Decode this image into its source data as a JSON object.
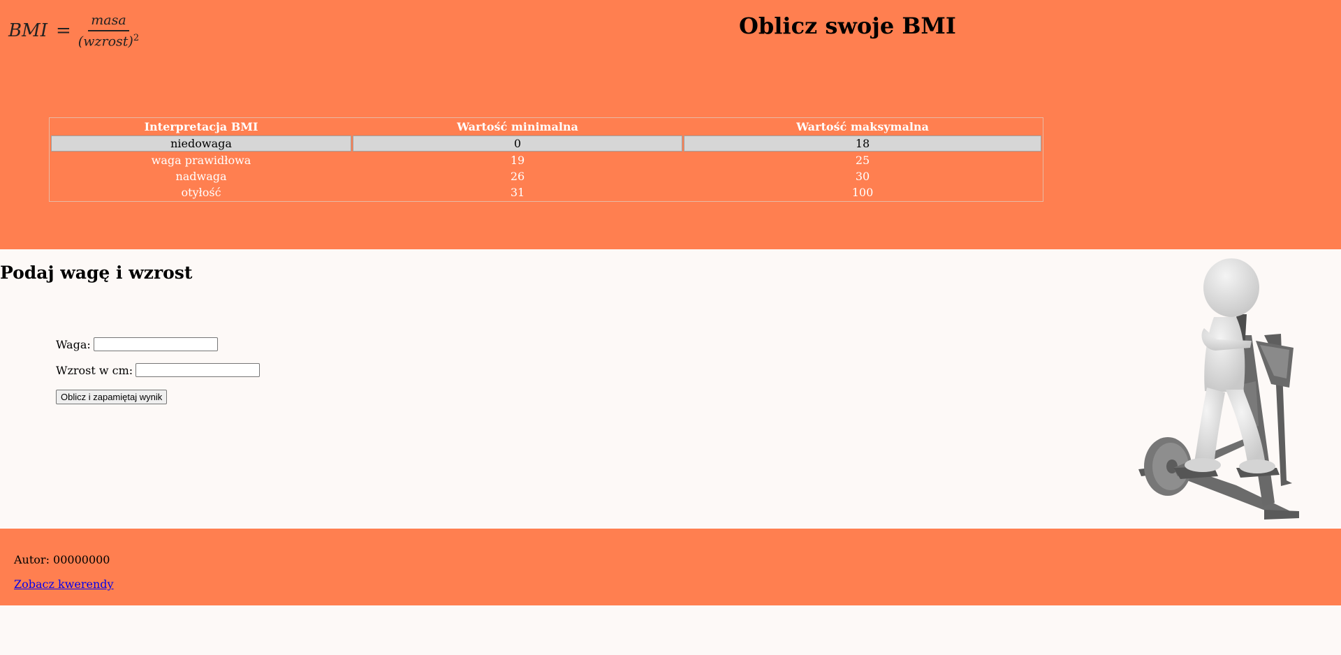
{
  "header": {
    "formula": {
      "lhs": "BMI",
      "equals": "=",
      "numerator": "masa",
      "denominator": "(wzrost)",
      "exponent": "2"
    },
    "title": "Oblicz swoje BMI"
  },
  "table": {
    "headers": [
      "Interpretacja BMI",
      "Wartość minimalna",
      "Wartość maksymalna"
    ],
    "rows": [
      [
        "niedowaga",
        "0",
        "18"
      ],
      [
        "waga prawidłowa",
        "19",
        "25"
      ],
      [
        "nadwaga",
        "26",
        "30"
      ],
      [
        "otyłość",
        "31",
        "100"
      ]
    ]
  },
  "form": {
    "heading": "Podaj wagę i wzrost",
    "weight_label": "Waga:",
    "weight_value": "",
    "height_label": "Wzrost w cm:",
    "height_value": "",
    "submit_label": "Oblicz i zapamiętaj wynik"
  },
  "footer": {
    "author": "Autor: 00000000",
    "link_label": "Zobacz kwerendy"
  },
  "colors": {
    "accent": "#ff7f50",
    "background": "#fdf9f7",
    "highlight_row": "#d6d6d6",
    "link": "#0000ee"
  }
}
